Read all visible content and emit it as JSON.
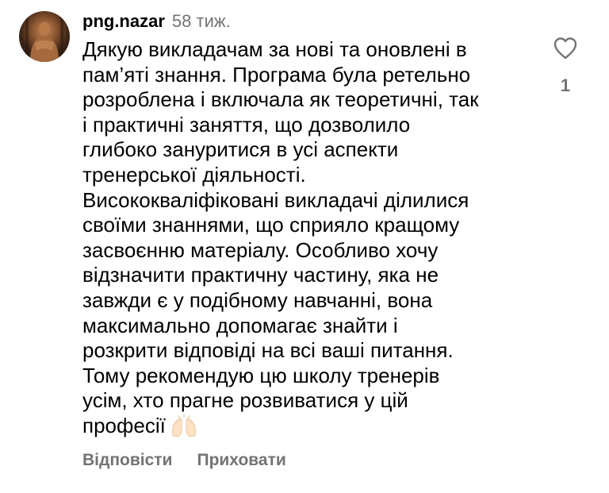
{
  "comment": {
    "username": "png.nazar",
    "timestamp": "58 тиж.",
    "text_lines": [
      "Дякую викладачам за нові та оновлені в",
      "пам’яті знання. Програма була ретельно",
      "розроблена і включала як теоретичні, так",
      "і практичні заняття, що дозволило",
      "глибоко зануритися в усі аспекти",
      "тренерської діяльності.",
      "Висококваліфіковані викладачі ділилися",
      "своїми знаннями, що сприяло кращому",
      "засвоєнню матеріалу. Особливо хочу",
      "відзначити практичну частину, яка не",
      "завжди є у подібному навчанні, вона",
      "максимально допомагає знайти і",
      "розкрити відповіді на всі ваші питання.",
      "Тому рекомендую цю школу тренерів",
      "усім, хто прагне розвиватися у цій",
      "професії"
    ],
    "emoji": "raising-hands-emoji",
    "likes": "1"
  },
  "actions": {
    "reply_label": "Відповісти",
    "hide_label": "Приховати"
  },
  "icons": {
    "like": "heart-outline-icon"
  },
  "colors": {
    "text": "#000000",
    "secondary": "#737373",
    "background": "#ffffff"
  }
}
